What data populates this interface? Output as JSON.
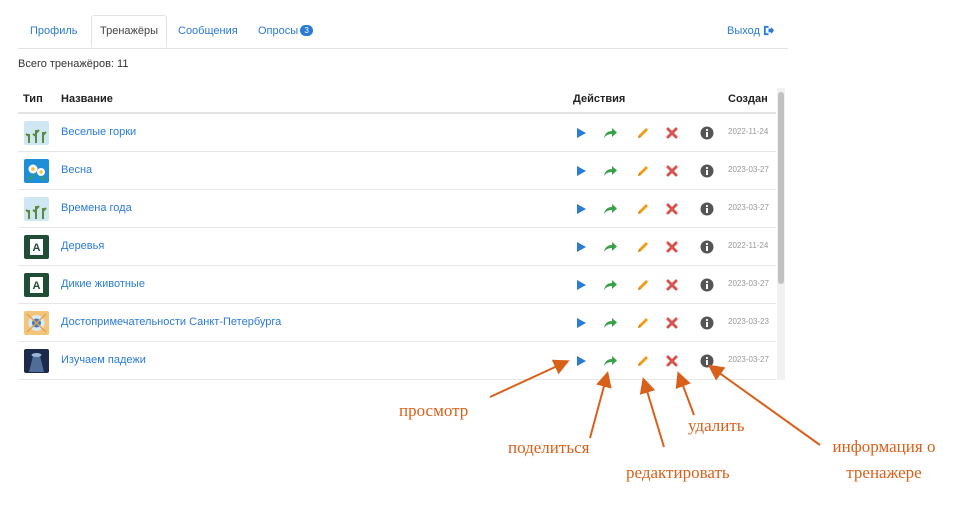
{
  "nav": {
    "tabs": [
      {
        "label": "Профиль",
        "active": false
      },
      {
        "label": "Тренажёры",
        "active": true
      },
      {
        "label": "Сообщения",
        "active": false
      },
      {
        "label": "Опросы",
        "active": false,
        "badge": "3"
      }
    ],
    "logout": "Выход",
    "logout_icon": "sign-out-icon"
  },
  "summary": "Всего тренажёров: 11",
  "table": {
    "headers": {
      "type": "Тип",
      "name": "Название",
      "actions": "Действия",
      "created": "Создан"
    },
    "rows": [
      {
        "title": "Веселые горки",
        "date": "2022-11-24",
        "thumb": "plants-thumbnail"
      },
      {
        "title": "Весна",
        "date": "2023-03-27",
        "thumb": "flowers-thumbnail"
      },
      {
        "title": "Времена года",
        "date": "2023-03-27",
        "thumb": "plants-thumbnail"
      },
      {
        "title": "Деревья",
        "date": "2022-11-24",
        "thumb": "letter-a-thumbnail"
      },
      {
        "title": "Дикие животные",
        "date": "2023-03-27",
        "thumb": "letter-a-thumbnail"
      },
      {
        "title": "Достопримечательности Санкт-Петербурга",
        "date": "2023-03-23",
        "thumb": "target-thumbnail"
      },
      {
        "title": "Изучаем падежи",
        "date": "2023-03-27",
        "thumb": "ufo-thumbnail"
      }
    ],
    "actions": [
      "play-icon",
      "share-icon",
      "pencil-icon",
      "delete-icon",
      "info-icon"
    ]
  },
  "annotations": {
    "view": "просмотр",
    "share": "поделиться",
    "edit": "редактировать",
    "delete": "удалить",
    "info_line1": "информация о",
    "info_line2": "тренажере"
  },
  "colors": {
    "link": "#2a7bd6",
    "play": "#2a7bd6",
    "share": "#3aa14b",
    "edit": "#f39c12",
    "delete": "#d9534f",
    "info": "#555555",
    "annotation": "#d9601a"
  }
}
